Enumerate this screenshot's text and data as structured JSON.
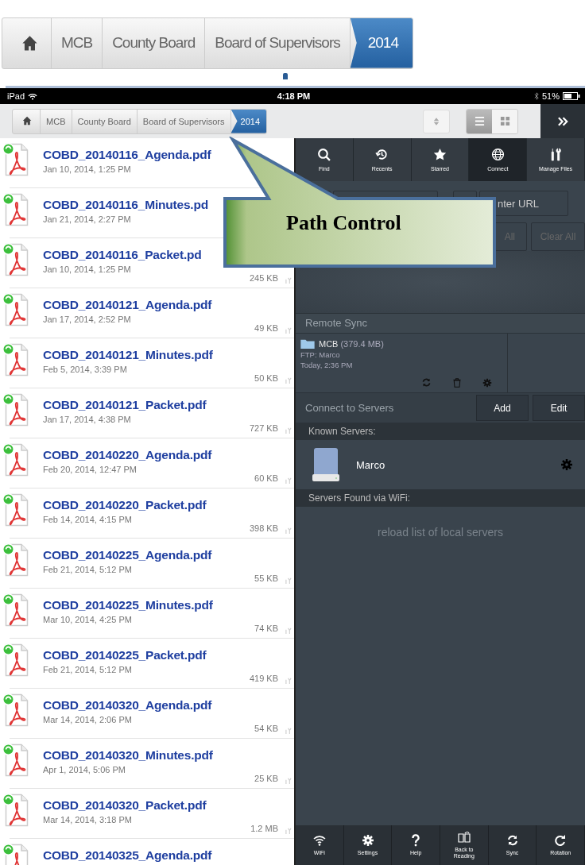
{
  "zoom_path": {
    "items": [
      {
        "kind": "home",
        "selected": false
      },
      {
        "kind": "text",
        "label": "MCB",
        "selected": false
      },
      {
        "kind": "text",
        "label": "County Board",
        "selected": false
      },
      {
        "kind": "text",
        "label": "Board of Supervisors",
        "selected": false
      },
      {
        "kind": "text",
        "label": "2014",
        "selected": true
      }
    ]
  },
  "status_bar": {
    "carrier": "iPad",
    "time": "4:18 PM",
    "battery": "51%"
  },
  "toolbar": {
    "path": [
      {
        "kind": "home",
        "selected": false
      },
      {
        "kind": "text",
        "label": "MCB",
        "selected": false
      },
      {
        "kind": "text",
        "label": "County Board",
        "selected": false
      },
      {
        "kind": "text",
        "label": "Board of Supervisors",
        "selected": false
      },
      {
        "kind": "text",
        "label": "2014",
        "selected": true
      }
    ],
    "view_modes": [
      {
        "kind": "list",
        "selected": true
      },
      {
        "kind": "grid",
        "selected": false
      }
    ]
  },
  "files": [
    {
      "name": "COBD_20140116_Agenda.pdf",
      "date": "Jan 10, 2014, 1:25 PM",
      "tagged": false
    },
    {
      "name": "COBD_20140116_Minutes.pd",
      "date": "Jan 21, 2014, 2:27 PM",
      "tagged": false
    },
    {
      "name": "COBD_20140116_Packet.pd",
      "date": "Jan 10, 2014, 1:25 PM",
      "size": "245 KB",
      "tagged": true
    },
    {
      "name": "COBD_20140121_Agenda.pdf",
      "date": "Jan 17, 2014, 2:52 PM",
      "size": "49 KB",
      "tagged": true
    },
    {
      "name": "COBD_20140121_Minutes.pdf",
      "date": "Feb 5, 2014, 3:39 PM",
      "size": "50 KB",
      "tagged": true
    },
    {
      "name": "COBD_20140121_Packet.pdf",
      "date": "Jan 17, 2014, 4:38 PM",
      "size": "727 KB",
      "tagged": true
    },
    {
      "name": "COBD_20140220_Agenda.pdf",
      "date": "Feb 20, 2014, 12:47 PM",
      "size": "60 KB",
      "tagged": true
    },
    {
      "name": "COBD_20140220_Packet.pdf",
      "date": "Feb 14, 2014, 4:15 PM",
      "size": "398 KB",
      "tagged": true
    },
    {
      "name": "COBD_20140225_Agenda.pdf",
      "date": "Feb 21, 2014, 5:12 PM",
      "size": "55 KB",
      "tagged": true
    },
    {
      "name": "COBD_20140225_Minutes.pdf",
      "date": "Mar 10, 2014, 4:25 PM",
      "size": "74 KB",
      "tagged": true
    },
    {
      "name": "COBD_20140225_Packet.pdf",
      "date": "Feb 21, 2014, 5:12 PM",
      "size": "419 KB",
      "tagged": true
    },
    {
      "name": "COBD_20140320_Agenda.pdf",
      "date": "Mar 14, 2014, 2:06 PM",
      "size": "54 KB",
      "tagged": true
    },
    {
      "name": "COBD_20140320_Minutes.pdf",
      "date": "Apr 1, 2014, 5:06 PM",
      "size": "25 KB",
      "tagged": true
    },
    {
      "name": "COBD_20140320_Packet.pdf",
      "date": "Mar 14, 2014, 3:18 PM",
      "size": "1.2 MB",
      "tagged": true
    },
    {
      "name": "COBD_20140325_Agenda.pdf",
      "tagged": false
    }
  ],
  "tabs": [
    {
      "label": "Find",
      "kind": "search",
      "selected": false
    },
    {
      "label": "Recents",
      "kind": "recent",
      "selected": false
    },
    {
      "label": "Starred",
      "kind": "star",
      "selected": false
    },
    {
      "label": "Connect",
      "kind": "globe",
      "selected": true
    },
    {
      "label": "Manage Files",
      "kind": "tools",
      "selected": false
    }
  ],
  "connect": {
    "url_button": "nter URL",
    "actions": [
      "All",
      "Clear All"
    ]
  },
  "remote_sync": {
    "title": "Remote Sync",
    "items": [
      {
        "name": "MCB",
        "size": "(379.4 MB)",
        "server": "FTP: Marco",
        "time": "Today, 2:36 PM"
      }
    ]
  },
  "servers": {
    "title": "Connect to Servers",
    "buttons": [
      "Add",
      "Edit"
    ],
    "known_title": "Known Servers:",
    "known": [
      {
        "name": "Marco"
      }
    ],
    "wifi_title": "Servers Found via WiFi:",
    "reload": "reload list of local servers"
  },
  "bottom_bar": [
    {
      "label": "WiFi",
      "kind": "wifi"
    },
    {
      "label": "Settings",
      "kind": "gear"
    },
    {
      "label": "Help",
      "kind": "help"
    },
    {
      "label": "Back to Reading",
      "kind": "book"
    },
    {
      "label": "Sync",
      "kind": "sync"
    },
    {
      "label": "Rotation",
      "kind": "rotate"
    }
  ],
  "callout": {
    "text": "Path Control"
  }
}
